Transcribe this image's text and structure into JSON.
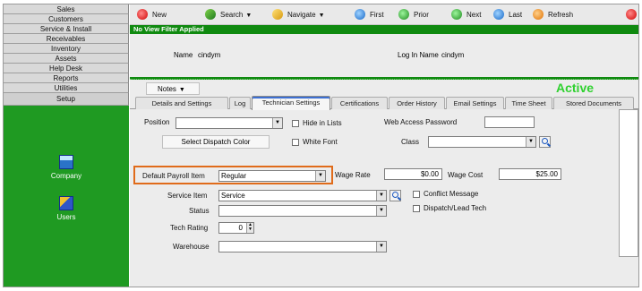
{
  "sidebar": {
    "menu": [
      "Sales",
      "Customers",
      "Service & Install",
      "Receivables",
      "Inventory",
      "Assets",
      "Help Desk",
      "Reports",
      "Utilities",
      "Setup"
    ],
    "tools": [
      "Company",
      "Users"
    ]
  },
  "toolbar": {
    "new": "New",
    "search": "Search",
    "navigate": "Navigate",
    "first": "First",
    "prior": "Prior",
    "next": "Next",
    "last": "Last",
    "refresh": "Refresh"
  },
  "filter_text": "No View Filter Applied",
  "record": {
    "name_label": "Name",
    "name_value": "cindym",
    "login_label": "Log In Name",
    "login_value": "cindym"
  },
  "notes_label": "Notes",
  "status": "Active",
  "tabs": [
    "Details and Settings",
    "Log",
    "Technician Settings",
    "Certifications",
    "Order History",
    "Email Settings",
    "Time Sheet",
    "Stored Documents"
  ],
  "form": {
    "position_label": "Position",
    "position_value": "",
    "hide_in_lists_label": "Hide in Lists",
    "web_access_password_label": "Web Access Password",
    "select_dispatch_color_label": "Select Dispatch Color",
    "white_font_label": "White Font",
    "class_label": "Class",
    "class_value": "",
    "default_payroll_item_label": "Default Payroll Item",
    "default_payroll_item_value": "Regular",
    "wage_rate_label": "Wage Rate",
    "wage_rate_value": "$0.00",
    "wage_cost_label": "Wage Cost",
    "wage_cost_value": "$25.00",
    "service_item_label": "Service Item",
    "service_item_value": "Service",
    "conflict_message_label": "Conflict Message",
    "status_label": "Status",
    "status_value": "",
    "dispatch_lead_tech_label": "Dispatch/Lead Tech",
    "tech_rating_label": "Tech Rating",
    "tech_rating_value": "0",
    "warehouse_label": "Warehouse",
    "warehouse_value": ""
  },
  "colors": {
    "sidebar_green": "#1f9a22",
    "filter_green": "#108a10",
    "active_green": "#2fd12f",
    "highlight_orange": "#e06b1a"
  }
}
